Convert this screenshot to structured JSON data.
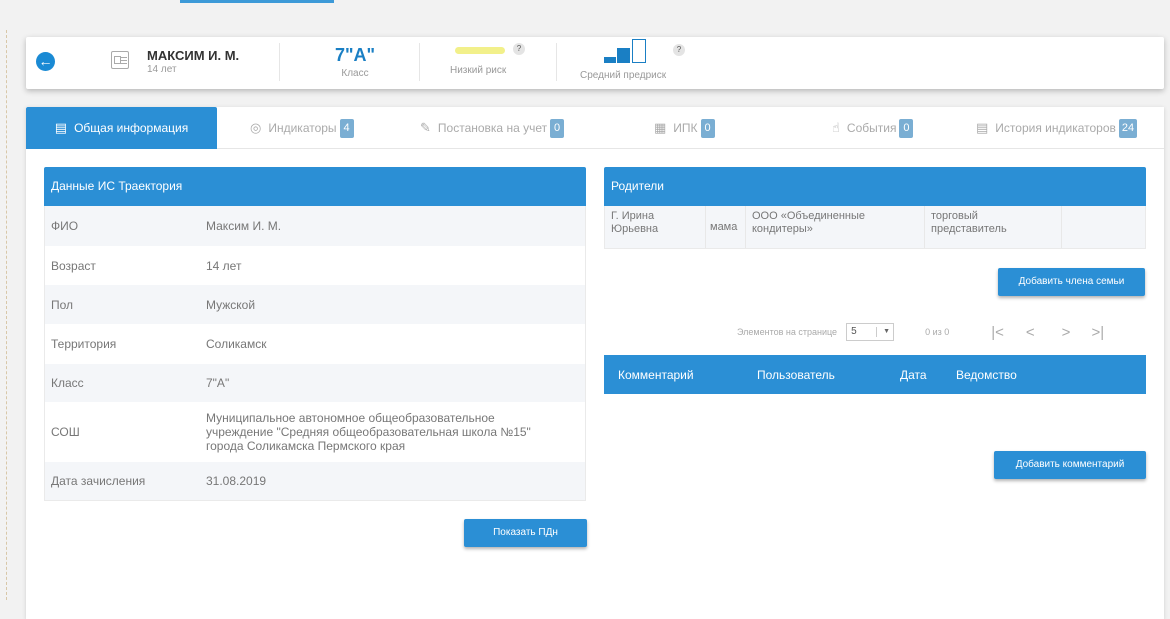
{
  "header": {
    "student_name": "МАКСИМ И. М.",
    "student_age": "14 лет",
    "class_value": "7\"А\"",
    "class_label": "Класс",
    "risk_label": "Низкий риск",
    "prerisk_label": "Средний предриск",
    "help_mark": "?",
    "colors": {
      "risk_bar": "#f2f08a",
      "accent": "#2b8fd5"
    }
  },
  "tabs": [
    {
      "label": "Общая информация",
      "icon": "id-card-icon"
    },
    {
      "label": "Индикаторы",
      "count": "4",
      "icon": "target-icon"
    },
    {
      "label": "Постановка на учет",
      "count": "0",
      "icon": "edit-icon"
    },
    {
      "label": "ИПК",
      "count": "0",
      "icon": "calendar-grid-icon"
    },
    {
      "label": "События",
      "count": "0",
      "icon": "hand-pointer-icon"
    },
    {
      "label": "История индикаторов",
      "count": "24",
      "icon": "calendar-icon"
    }
  ],
  "info": {
    "title": "Данные ИС Траектория",
    "rows": [
      {
        "key": "ФИО",
        "value": "Максим И. М."
      },
      {
        "key": "Возраст",
        "value": "14 лет"
      },
      {
        "key": "Пол",
        "value": "Мужской"
      },
      {
        "key": "Территория",
        "value": "Соликамск"
      },
      {
        "key": "Класс",
        "value": "7\"А\""
      },
      {
        "key": "СОШ",
        "value": "Муниципальное автономное общеобразовательное учреждение \"Средняя общеобразовательная школа №15\" города Соликамска Пермского края"
      },
      {
        "key": "Дата зачисления",
        "value": "31.08.2019"
      }
    ],
    "show_button": "Показать ПДн"
  },
  "parents": {
    "title": "Родители",
    "rows": [
      {
        "name": "Г. Ирина Юрьевна",
        "relation": "мама",
        "organization": "ООО «Объединенные кондитеры»",
        "position": "торговый представитель"
      }
    ],
    "add_button": "Добавить члена семьи"
  },
  "pager": {
    "per_page_label": "Элементов на странице",
    "per_page_value": "5",
    "range": "0 из 0",
    "first": "|<",
    "prev": "<",
    "next": ">",
    "last": ">|"
  },
  "comments": {
    "columns": [
      "Комментарий",
      "Пользователь",
      "Дата",
      "Ведомство"
    ],
    "add_button": "Добавить комментарий"
  }
}
